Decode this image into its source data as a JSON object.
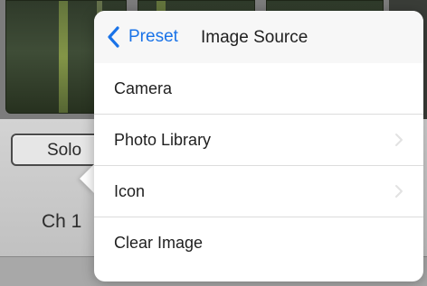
{
  "app": {
    "solo_label": "Solo",
    "channel_label": "Ch 1"
  },
  "popover": {
    "back_label": "Preset",
    "title": "Image Source",
    "items": [
      {
        "label": "Camera",
        "has_chevron": false
      },
      {
        "label": "Photo Library",
        "has_chevron": true
      },
      {
        "label": "Icon",
        "has_chevron": true
      },
      {
        "label": "Clear Image",
        "has_chevron": false
      }
    ]
  },
  "colors": {
    "accent": "#1a73e8",
    "popover_bg": "#ffffff",
    "separator": "#dcdcdc"
  },
  "icons": {
    "back": "chevron-left-icon",
    "disclosure": "chevron-right-icon"
  }
}
